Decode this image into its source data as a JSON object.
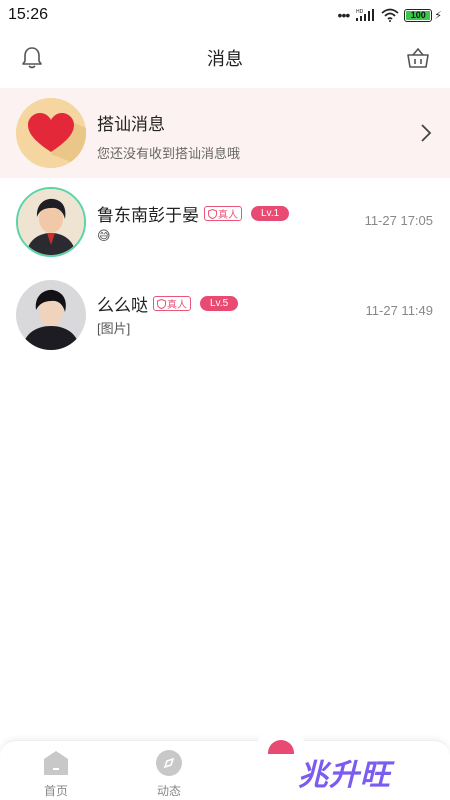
{
  "status": {
    "time": "15:26",
    "battery": "100",
    "network": "HD"
  },
  "header": {
    "title": "消息"
  },
  "flirt": {
    "title": "搭讪消息",
    "subtitle": "您还没有收到搭讪消息哦"
  },
  "messages": [
    {
      "name": "鲁东南彭于晏",
      "badge_real": "真人",
      "level": "Lv.1",
      "preview": "😅",
      "time": "11-27 17:05"
    },
    {
      "name": "么么哒",
      "badge_real": "真人",
      "level": "Lv.5",
      "preview": "[图片]",
      "time": "11-27 11:49"
    }
  ],
  "tabs": [
    {
      "label": "首页",
      "icon": "home-icon"
    },
    {
      "label": "动态",
      "icon": "compass-icon"
    }
  ],
  "watermark": "兆升旺",
  "colors": {
    "accent": "#e94a72",
    "flirt_bg": "#fdf2f2",
    "ring": "#5bd3a6"
  }
}
